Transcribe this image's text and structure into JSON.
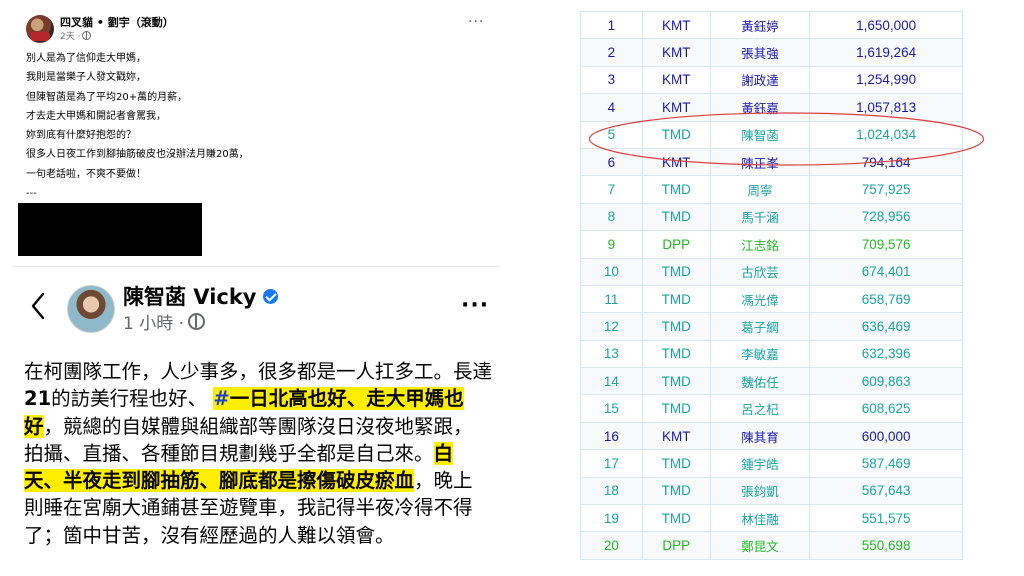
{
  "post1": {
    "author": "四叉貓 • 劉宇（滾動）",
    "time": "2天 ·",
    "lines": [
      "別人是為了信仰走大甲媽，",
      "我則是當樂子人發文戳妳，",
      "但陳智菡是為了平均20+萬的月薪，",
      "才去走大甲媽和開記者會罵我，",
      "妳到底有什麼好抱怨的？",
      "很多人日夜工作到腳抽筋破皮也沒辦法月賺20萬，",
      "一句老話啦，不爽不要做！",
      "---"
    ]
  },
  "post2": {
    "author": "陳智菡 Vicky",
    "time": "1 小時 ·",
    "body": {
      "t1": "在柯團隊工作，人少事多，很多都是一人扛多工。長達",
      "num": "21",
      "t2": "的訪美行程也好、 ",
      "tag": "#",
      "hl1": "一日北高也好、走大甲媽也好",
      "t3": "，競總的自媒體與組織部等團隊沒日沒夜地緊跟，拍攝、直播、各種節目規劃幾乎全都是自己來。",
      "hl2": "白天、半夜走到腳抽筋、腳底都是擦傷破皮瘀血",
      "t4": "，晚上則睡在宮廟大通鋪甚至遊覽車，我記得半夜冷得不得了；箇中甘苦，沒有經歷過的人難以領會。"
    }
  },
  "colors": {
    "KMT": "#1a1aa8",
    "TMD": "#1aa3a3",
    "DPP": "#22b822",
    "highlight": "#ffee00",
    "circle": "#d94040"
  },
  "ranking": {
    "rows": [
      {
        "rank": "1",
        "party": "KMT",
        "name": "黃鈺婷",
        "votes": "1,650,000"
      },
      {
        "rank": "2",
        "party": "KMT",
        "name": "張其強",
        "votes": "1,619,264"
      },
      {
        "rank": "3",
        "party": "KMT",
        "name": "謝政達",
        "votes": "1,254,990"
      },
      {
        "rank": "4",
        "party": "KMT",
        "name": "黃鈺嘉",
        "votes": "1,057,813"
      },
      {
        "rank": "5",
        "party": "TMD",
        "name": "陳智菡",
        "votes": "1,024,034",
        "circled": true
      },
      {
        "rank": "6",
        "party": "KMT",
        "name": "陳正峯",
        "votes": "794,164"
      },
      {
        "rank": "7",
        "party": "TMD",
        "name": "周寧",
        "votes": "757,925"
      },
      {
        "rank": "8",
        "party": "TMD",
        "name": "馬千涵",
        "votes": "728,956"
      },
      {
        "rank": "9",
        "party": "DPP",
        "name": "江志銘",
        "votes": "709,576"
      },
      {
        "rank": "10",
        "party": "TMD",
        "name": "古欣芸",
        "votes": "674,401"
      },
      {
        "rank": "11",
        "party": "TMD",
        "name": "馮光偉",
        "votes": "658,769"
      },
      {
        "rank": "12",
        "party": "TMD",
        "name": "葛子綱",
        "votes": "636,469"
      },
      {
        "rank": "13",
        "party": "TMD",
        "name": "李敏嘉",
        "votes": "632,396"
      },
      {
        "rank": "14",
        "party": "TMD",
        "name": "魏佑任",
        "votes": "609,863"
      },
      {
        "rank": "15",
        "party": "TMD",
        "name": "呂之杞",
        "votes": "608,625"
      },
      {
        "rank": "16",
        "party": "KMT",
        "name": "陳其育",
        "votes": "600,000"
      },
      {
        "rank": "17",
        "party": "TMD",
        "name": "鍾宇皓",
        "votes": "587,469"
      },
      {
        "rank": "18",
        "party": "TMD",
        "name": "張鈞凱",
        "votes": "567,643"
      },
      {
        "rank": "19",
        "party": "TMD",
        "name": "林佳融",
        "votes": "551,575"
      },
      {
        "rank": "20",
        "party": "DPP",
        "name": "鄭昆文",
        "votes": "550,698"
      }
    ]
  }
}
